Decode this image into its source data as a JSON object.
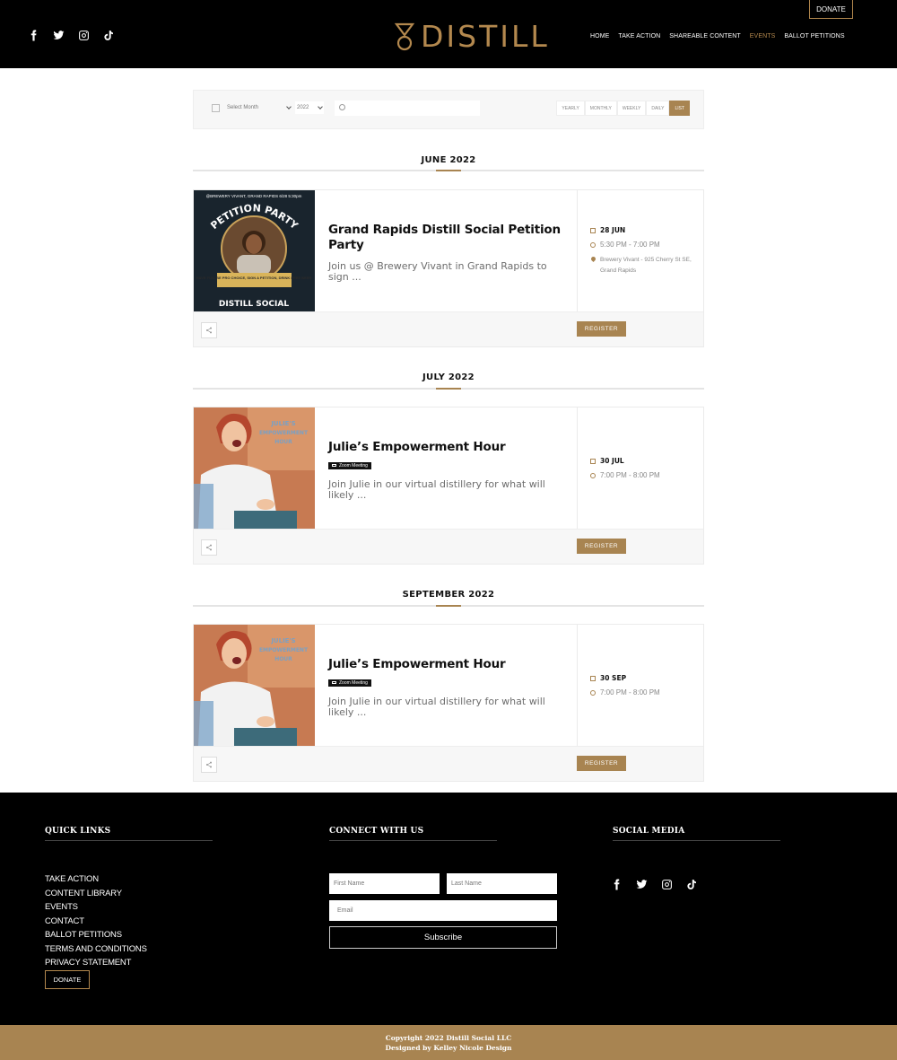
{
  "header": {
    "logo_text": "DISTILL",
    "donate_label": "DONATE",
    "social_icons": [
      "facebook-icon",
      "twitter-icon",
      "instagram-icon",
      "tiktok-icon"
    ],
    "nav": [
      {
        "label": "HOME",
        "active": false
      },
      {
        "label": "TAKE ACTION",
        "active": false
      },
      {
        "label": "SHAREABLE CONTENT",
        "active": false
      },
      {
        "label": "EVENTS",
        "active": true
      },
      {
        "label": "BALLOT PETITIONS",
        "active": false
      }
    ]
  },
  "filter": {
    "month_select": "Select Month",
    "year_select": "2022",
    "search_placeholder": "",
    "views": [
      "YEARLY",
      "MONTHLY",
      "WEEKLY",
      "DAILY",
      "LIST"
    ],
    "active_view": "LIST"
  },
  "months": [
    {
      "heading": "JUNE 2022",
      "event": {
        "title": "Grand Rapids Distill Social Petition Party",
        "tag": "",
        "description": "Join us @ Brewery Vivant in Grand Rapids to sign ...",
        "date": "28 JUN",
        "time": "5:30 PM - 7:00 PM",
        "location": "Brewery Vivant - 925 Cherry St SE, Grand Rapids",
        "register": "REGISTER",
        "poster_lines": [
          "@BREWERY VIVANT, GRAND RAPIDS 6/28 5:30pm",
          "PETITION PARTY",
          "HAVE FUN, BE PRO CHOICE, SIGN A PETITION, DRINK FREE BEER",
          "DISTILL SOCIAL"
        ]
      }
    },
    {
      "heading": "JULY 2022",
      "event": {
        "title": "Julie’s Empowerment Hour",
        "tag": "Zoom Meeting",
        "description": "Join Julie in our virtual distillery for what will likely ...",
        "date": "30 JUL",
        "time": "7:00 PM - 8:00 PM",
        "location": "",
        "register": "REGISTER",
        "poster_lines": [
          "JULIE'S",
          "EMPOWERMENT",
          "HOUR"
        ]
      }
    },
    {
      "heading": "SEPTEMBER 2022",
      "event": {
        "title": "Julie’s Empowerment Hour",
        "tag": "Zoom Meeting",
        "description": "Join Julie in our virtual distillery for what will likely ...",
        "date": "30 SEP",
        "time": "7:00 PM - 8:00 PM",
        "location": "",
        "register": "REGISTER",
        "poster_lines": [
          "JULIE'S",
          "EMPOWERMENT",
          "HOUR"
        ]
      }
    }
  ],
  "footer": {
    "quick_links_title": "QUICK LINKS",
    "quick_links": [
      "TAKE ACTION",
      "CONTENT LIBRARY",
      "EVENTS",
      "CONTACT",
      "BALLOT PETITIONS",
      "TERMS AND CONDITIONS",
      "PRIVACY STATEMENT"
    ],
    "donate_label": "DONATE",
    "connect_title": "CONNECT WITH US",
    "first_name_placeholder": "First Name",
    "last_name_placeholder": "Last Name",
    "email_placeholder": "Email",
    "subscribe_label": "Subscribe",
    "social_title": "SOCIAL MEDIA",
    "copyright": "Copyright 2022 Distill Social LLC",
    "designed_by": "Designed by Kelley Nicole Design"
  },
  "colors": {
    "accent": "#a88451",
    "logo": "#b3884e",
    "header_bg": "#000000"
  }
}
